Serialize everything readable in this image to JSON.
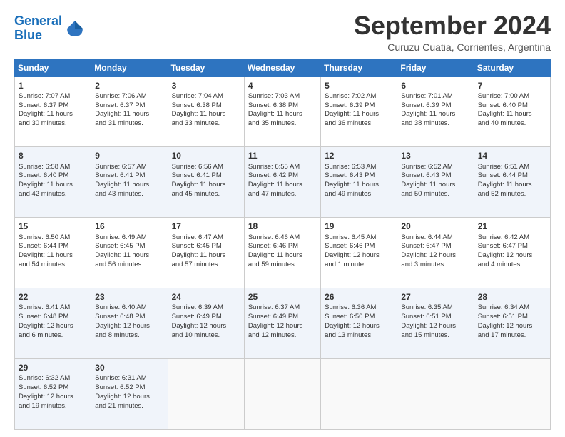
{
  "logo": {
    "line1": "General",
    "line2": "Blue"
  },
  "title": "September 2024",
  "subtitle": "Curuzu Cuatia, Corrientes, Argentina",
  "weekdays": [
    "Sunday",
    "Monday",
    "Tuesday",
    "Wednesday",
    "Thursday",
    "Friday",
    "Saturday"
  ],
  "weeks": [
    [
      {
        "day": "1",
        "info": "Sunrise: 7:07 AM\nSunset: 6:37 PM\nDaylight: 11 hours\nand 30 minutes."
      },
      {
        "day": "2",
        "info": "Sunrise: 7:06 AM\nSunset: 6:37 PM\nDaylight: 11 hours\nand 31 minutes."
      },
      {
        "day": "3",
        "info": "Sunrise: 7:04 AM\nSunset: 6:38 PM\nDaylight: 11 hours\nand 33 minutes."
      },
      {
        "day": "4",
        "info": "Sunrise: 7:03 AM\nSunset: 6:38 PM\nDaylight: 11 hours\nand 35 minutes."
      },
      {
        "day": "5",
        "info": "Sunrise: 7:02 AM\nSunset: 6:39 PM\nDaylight: 11 hours\nand 36 minutes."
      },
      {
        "day": "6",
        "info": "Sunrise: 7:01 AM\nSunset: 6:39 PM\nDaylight: 11 hours\nand 38 minutes."
      },
      {
        "day": "7",
        "info": "Sunrise: 7:00 AM\nSunset: 6:40 PM\nDaylight: 11 hours\nand 40 minutes."
      }
    ],
    [
      {
        "day": "8",
        "info": "Sunrise: 6:58 AM\nSunset: 6:40 PM\nDaylight: 11 hours\nand 42 minutes."
      },
      {
        "day": "9",
        "info": "Sunrise: 6:57 AM\nSunset: 6:41 PM\nDaylight: 11 hours\nand 43 minutes."
      },
      {
        "day": "10",
        "info": "Sunrise: 6:56 AM\nSunset: 6:41 PM\nDaylight: 11 hours\nand 45 minutes."
      },
      {
        "day": "11",
        "info": "Sunrise: 6:55 AM\nSunset: 6:42 PM\nDaylight: 11 hours\nand 47 minutes."
      },
      {
        "day": "12",
        "info": "Sunrise: 6:53 AM\nSunset: 6:43 PM\nDaylight: 11 hours\nand 49 minutes."
      },
      {
        "day": "13",
        "info": "Sunrise: 6:52 AM\nSunset: 6:43 PM\nDaylight: 11 hours\nand 50 minutes."
      },
      {
        "day": "14",
        "info": "Sunrise: 6:51 AM\nSunset: 6:44 PM\nDaylight: 11 hours\nand 52 minutes."
      }
    ],
    [
      {
        "day": "15",
        "info": "Sunrise: 6:50 AM\nSunset: 6:44 PM\nDaylight: 11 hours\nand 54 minutes."
      },
      {
        "day": "16",
        "info": "Sunrise: 6:49 AM\nSunset: 6:45 PM\nDaylight: 11 hours\nand 56 minutes."
      },
      {
        "day": "17",
        "info": "Sunrise: 6:47 AM\nSunset: 6:45 PM\nDaylight: 11 hours\nand 57 minutes."
      },
      {
        "day": "18",
        "info": "Sunrise: 6:46 AM\nSunset: 6:46 PM\nDaylight: 11 hours\nand 59 minutes."
      },
      {
        "day": "19",
        "info": "Sunrise: 6:45 AM\nSunset: 6:46 PM\nDaylight: 12 hours\nand 1 minute."
      },
      {
        "day": "20",
        "info": "Sunrise: 6:44 AM\nSunset: 6:47 PM\nDaylight: 12 hours\nand 3 minutes."
      },
      {
        "day": "21",
        "info": "Sunrise: 6:42 AM\nSunset: 6:47 PM\nDaylight: 12 hours\nand 4 minutes."
      }
    ],
    [
      {
        "day": "22",
        "info": "Sunrise: 6:41 AM\nSunset: 6:48 PM\nDaylight: 12 hours\nand 6 minutes."
      },
      {
        "day": "23",
        "info": "Sunrise: 6:40 AM\nSunset: 6:48 PM\nDaylight: 12 hours\nand 8 minutes."
      },
      {
        "day": "24",
        "info": "Sunrise: 6:39 AM\nSunset: 6:49 PM\nDaylight: 12 hours\nand 10 minutes."
      },
      {
        "day": "25",
        "info": "Sunrise: 6:37 AM\nSunset: 6:49 PM\nDaylight: 12 hours\nand 12 minutes."
      },
      {
        "day": "26",
        "info": "Sunrise: 6:36 AM\nSunset: 6:50 PM\nDaylight: 12 hours\nand 13 minutes."
      },
      {
        "day": "27",
        "info": "Sunrise: 6:35 AM\nSunset: 6:51 PM\nDaylight: 12 hours\nand 15 minutes."
      },
      {
        "day": "28",
        "info": "Sunrise: 6:34 AM\nSunset: 6:51 PM\nDaylight: 12 hours\nand 17 minutes."
      }
    ],
    [
      {
        "day": "29",
        "info": "Sunrise: 6:32 AM\nSunset: 6:52 PM\nDaylight: 12 hours\nand 19 minutes."
      },
      {
        "day": "30",
        "info": "Sunrise: 6:31 AM\nSunset: 6:52 PM\nDaylight: 12 hours\nand 21 minutes."
      },
      {
        "day": "",
        "info": ""
      },
      {
        "day": "",
        "info": ""
      },
      {
        "day": "",
        "info": ""
      },
      {
        "day": "",
        "info": ""
      },
      {
        "day": "",
        "info": ""
      }
    ]
  ]
}
